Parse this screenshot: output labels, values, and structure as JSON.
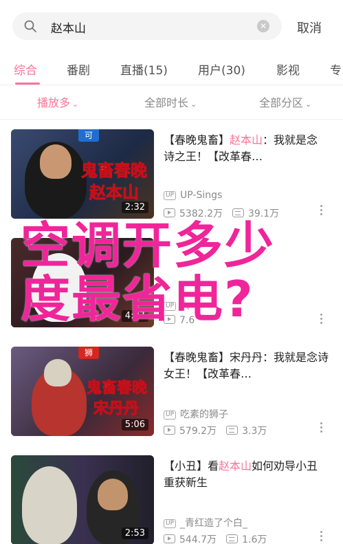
{
  "search": {
    "query": "赵本山",
    "cancel_label": "取消"
  },
  "tabs": [
    {
      "label": "综合",
      "active": true
    },
    {
      "label": "番剧"
    },
    {
      "label": "直播(15)"
    },
    {
      "label": "用户(30)"
    },
    {
      "label": "影视"
    },
    {
      "label": "专"
    }
  ],
  "filters": [
    {
      "label": "播放多",
      "active": true
    },
    {
      "label": "全部时长"
    },
    {
      "label": "全部分区"
    }
  ],
  "videos": [
    {
      "title_pre": "【春晚鬼畜】",
      "title_hl": "赵本山",
      "title_post": "：我就是念诗之王！【改革春…",
      "up": "UP-Sings",
      "plays": "5382.2万",
      "danmaku": "39.1万",
      "duration": "2:32",
      "badge": "可",
      "caption_line1": "鬼畜春晚",
      "caption_line2": "赵本山"
    },
    {
      "title_pre": "",
      "title_hl": "",
      "title_post": "",
      "up": "",
      "plays": "",
      "danmaku": "",
      "duration": "4:37",
      "partial_up": "大",
      "partial_stat": "7.6"
    },
    {
      "title_pre": "【春晚鬼畜】宋丹丹：我就是念诗女王！【改革春…",
      "title_hl": "",
      "title_post": "",
      "up": "吃素的狮子",
      "plays": "579.2万",
      "danmaku": "3.3万",
      "duration": "5:06",
      "badge": "狮",
      "caption_line1": "鬼畜春晚",
      "caption_line2": "宋丹丹"
    },
    {
      "title_pre": "【小丑】看",
      "title_hl": "赵本山",
      "title_post": "如何劝导小丑重获新生",
      "up": "_青红造了个白_",
      "plays": "544.7万",
      "danmaku": "1.6万",
      "duration": "2:53"
    }
  ],
  "overlay": {
    "line1": "空调开多少",
    "line2": "度最省电?"
  },
  "colors": {
    "accent": "#fb7299",
    "overlay": "#f0259a"
  }
}
